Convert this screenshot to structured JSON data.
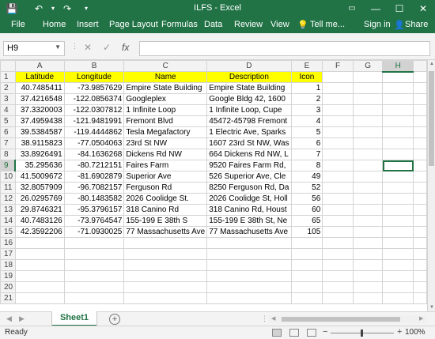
{
  "window": {
    "title": "ILFS - Excel",
    "minimize": "—",
    "maximize": "☐",
    "close": "✕"
  },
  "quick_access": {
    "save": "💾",
    "undo": "↶",
    "redo": "↷",
    "customize": "▾"
  },
  "ribbon": {
    "tabs": [
      "File",
      "Home",
      "Insert",
      "Page Layout",
      "Formulas",
      "Data",
      "Review",
      "View"
    ],
    "tell_me": "Tell me...",
    "sign_in": "Sign in",
    "share": "Share"
  },
  "formula_bar": {
    "name_box": "H9",
    "cancel": "✕",
    "enter": "✓",
    "fx": "fx",
    "formula": ""
  },
  "sheet": {
    "columns": [
      "A",
      "B",
      "C",
      "D",
      "E",
      "F",
      "G",
      "H"
    ],
    "headers": [
      "Latitude",
      "Longitude",
      "Name",
      "Description",
      "Icon"
    ],
    "rows": [
      [
        "40.7485411",
        "-73.9857629",
        "Empire State Building",
        "Empire State Building",
        "1"
      ],
      [
        "37.4216548",
        "-122.0856374",
        "Googleplex",
        "Google Bldg 42, 1600",
        "2"
      ],
      [
        "37.3320003",
        "-122.0307812",
        "1 Infinite Loop",
        "1 Infinite Loop, Cupe",
        "3"
      ],
      [
        "37.4959438",
        "-121.9481991",
        "Fremont Blvd",
        "45472-45798 Fremont",
        "4"
      ],
      [
        "39.5384587",
        "-119.4444862",
        "Tesla Megafactory",
        "1 Electric Ave, Sparks",
        "5"
      ],
      [
        "38.9115823",
        "-77.0504063",
        "23rd St NW",
        "1607 23rd St NW, Was",
        "6"
      ],
      [
        "33.8926491",
        "-84.1636268",
        "Dickens Rd NW",
        "664 Dickens Rd NW, L",
        "7"
      ],
      [
        "35.295636",
        "-80.7212151",
        "Faires Farm",
        "9520 Faires Farm Rd,",
        "8"
      ],
      [
        "41.5009672",
        "-81.6902879",
        "Superior Ave",
        "526 Superior Ave, Cle",
        "49"
      ],
      [
        "32.8057909",
        "-96.7082157",
        "Ferguson Rd",
        "8250 Ferguson Rd, Da",
        "52"
      ],
      [
        "26.0295769",
        "-80.1483582",
        "2026 Coolidge St.",
        "2026 Coolidge St, Holl",
        "56"
      ],
      [
        "29.8746321",
        "-95.3796157",
        "318 Canino Rd",
        "318 Canino Rd, Houst",
        "60"
      ],
      [
        "40.7483126",
        "-73.9764547",
        "155-199 E 38th S",
        "155-199 E 38th St, Ne",
        "65"
      ],
      [
        "42.3592206",
        "-71.0930025",
        "77 Massachusetts Ave",
        "77 Massachusetts Ave",
        "105"
      ]
    ],
    "row_numbers": [
      "1",
      "2",
      "3",
      "4",
      "5",
      "6",
      "7",
      "8",
      "9",
      "10",
      "11",
      "12",
      "13",
      "14",
      "15",
      "16",
      "17",
      "18",
      "19",
      "20",
      "21"
    ],
    "active_cell": "H9"
  },
  "sheet_tabs": {
    "active": "Sheet1",
    "add": "+"
  },
  "status": {
    "ready": "Ready",
    "zoom": "100%",
    "zoom_out": "−",
    "zoom_in": "+"
  },
  "colors": {
    "excel_green": "#217346",
    "header_fill": "#ffff00"
  }
}
